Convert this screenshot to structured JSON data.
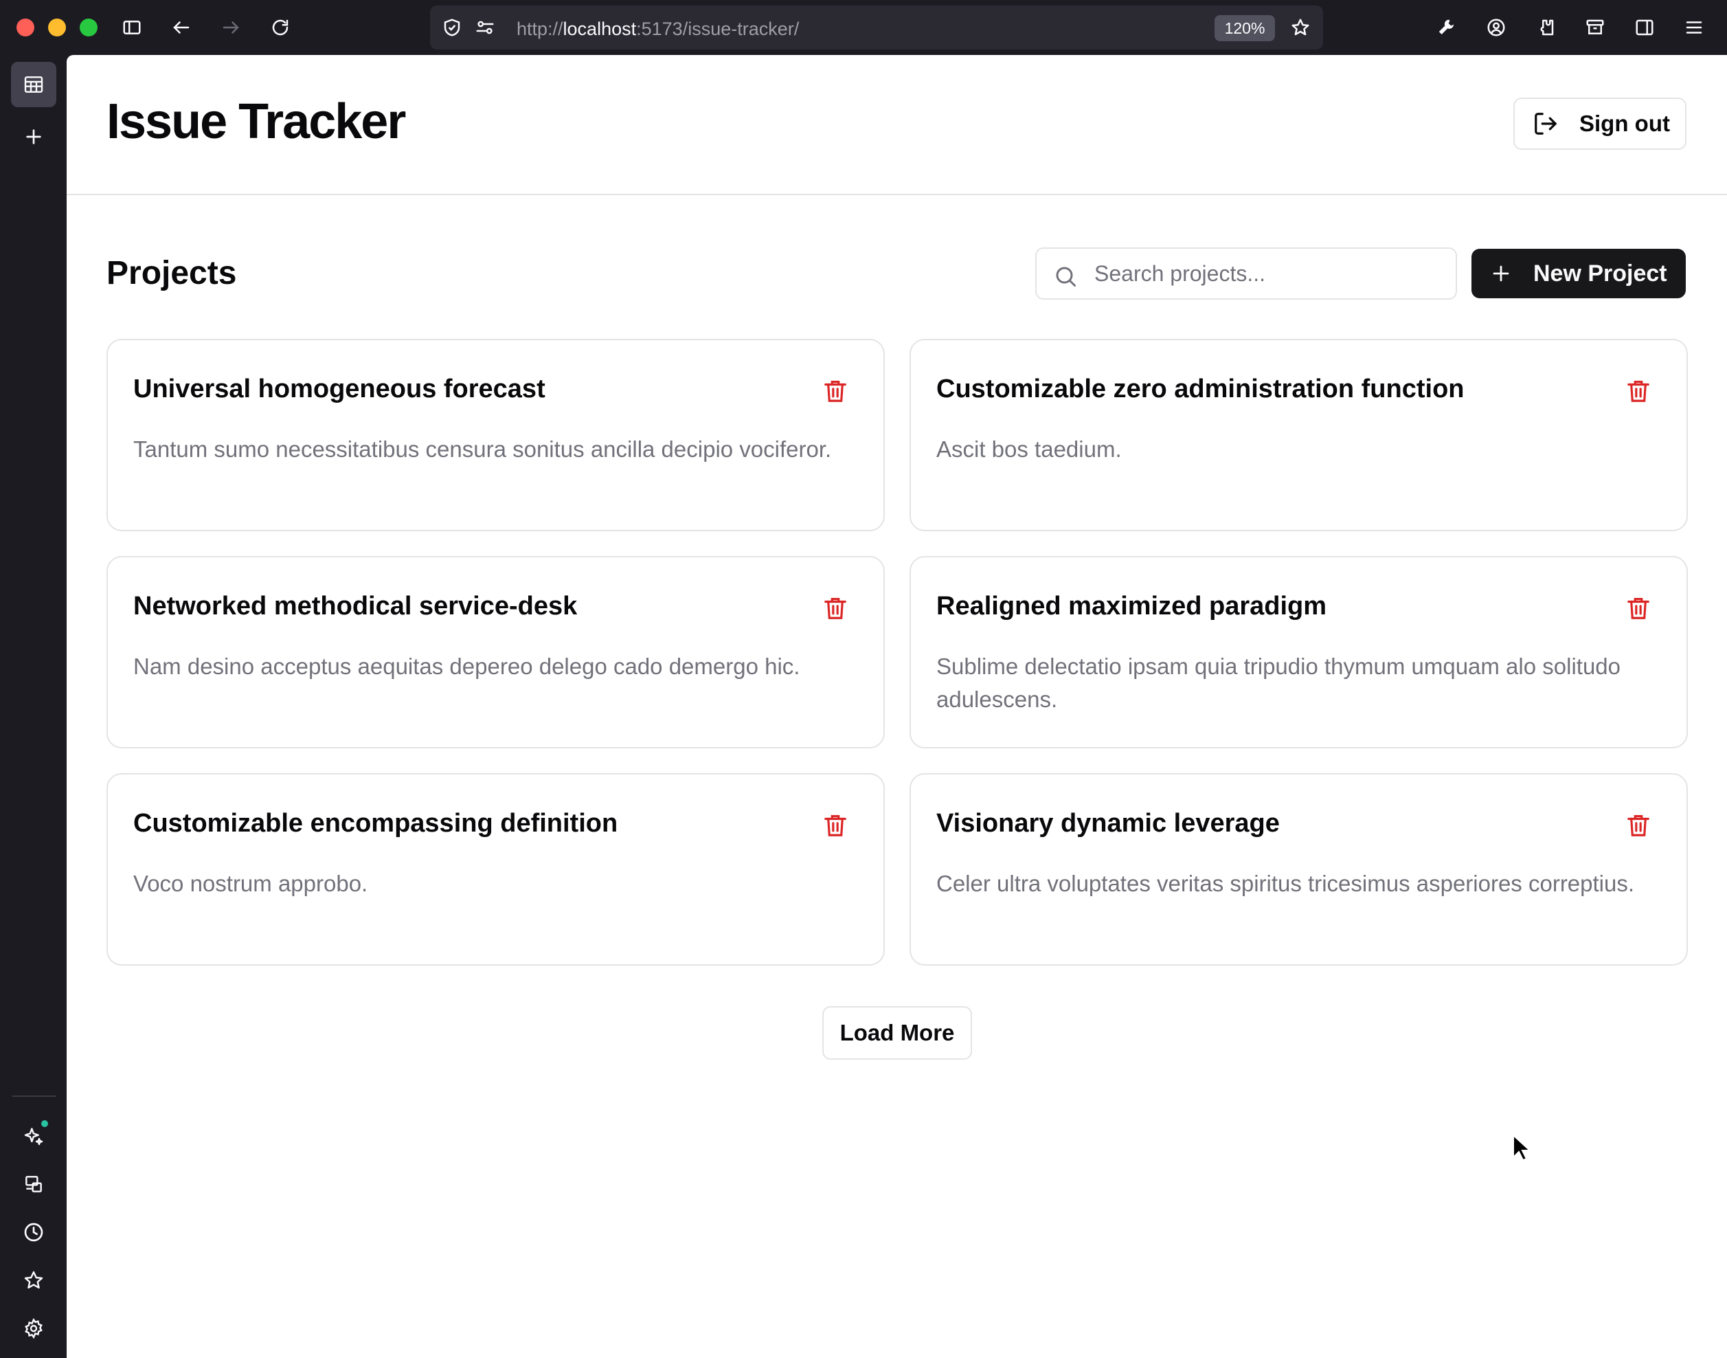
{
  "browser": {
    "url_prefix": "http://",
    "url_host": "localhost",
    "url_path": ":5173/issue-tracker/",
    "zoom": "120%"
  },
  "header": {
    "title": "Issue Tracker",
    "signout_label": "Sign out"
  },
  "toolbar": {
    "section_title": "Projects",
    "search_placeholder": "Search projects...",
    "new_project_label": "New Project"
  },
  "projects": [
    {
      "title": "Universal homogeneous forecast",
      "description": "Tantum sumo necessitatibus censura sonitus ancilla decipio vociferor."
    },
    {
      "title": "Customizable zero administration function",
      "description": "Ascit bos taedium."
    },
    {
      "title": "Networked methodical service-desk",
      "description": "Nam desino acceptus aequitas depereo delego cado demergo hic."
    },
    {
      "title": "Realigned maximized paradigm",
      "description": "Sublime delectatio ipsam quia tripudio thymum umquam alo solitudo adulescens."
    },
    {
      "title": "Customizable encompassing definition",
      "description": "Voco nostrum approbo."
    },
    {
      "title": "Visionary dynamic leverage",
      "description": "Celer ultra voluptates veritas spiritus tricesimus asperiores correptius."
    }
  ],
  "load_more_label": "Load More",
  "colors": {
    "primary": "#18181b",
    "delete": "#dc2626",
    "border": "#e4e4e7",
    "muted_text": "#71717a"
  },
  "icons": {
    "signout": "log-out-icon",
    "search": "search-icon",
    "new_project": "plus-icon",
    "delete": "trash-icon"
  }
}
